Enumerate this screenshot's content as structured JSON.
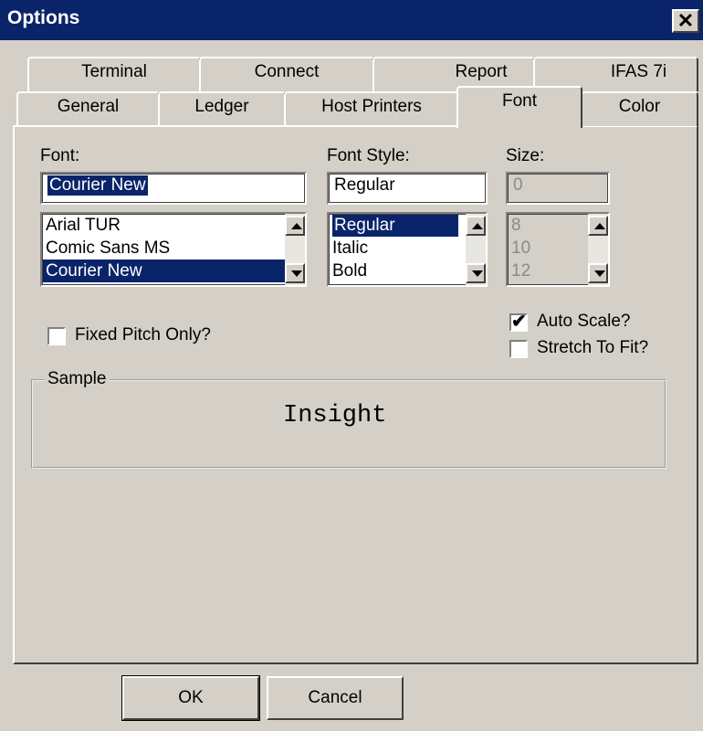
{
  "window": {
    "title": "Options",
    "close_label": "✕"
  },
  "tabs_back": [
    "Terminal",
    "Connect",
    "Report",
    "IFAS 7i"
  ],
  "tabs_front": [
    "General",
    "Ledger",
    "Host Printers",
    "Font",
    "Color"
  ],
  "font": {
    "label": "Font:",
    "value": "Courier New",
    "items": [
      "Arial TUR",
      "Comic Sans MS",
      "Courier New"
    ],
    "selected": "Courier New"
  },
  "font_style": {
    "label": "Font Style:",
    "value": "Regular",
    "items": [
      "Regular",
      "Italic",
      "Bold"
    ],
    "selected": "Regular"
  },
  "size": {
    "label": "Size:",
    "value": "0",
    "items": [
      "8",
      "10",
      "12"
    ]
  },
  "options": {
    "fixed_pitch": {
      "label": "Fixed Pitch Only?",
      "checked": false
    },
    "auto_scale": {
      "label": "Auto Scale?",
      "checked": true
    },
    "stretch": {
      "label": "Stretch To Fit?",
      "checked": false
    }
  },
  "sample": {
    "label": "Sample",
    "text": "Insight"
  },
  "buttons": {
    "ok": "OK",
    "cancel": "Cancel"
  },
  "colors": {
    "titlebar": "#0a246a",
    "face": "#d4d0c8",
    "selection": "#0a246a"
  },
  "icons": [
    "close-icon",
    "scroll-up-icon",
    "scroll-down-icon",
    "checkmark-icon"
  ]
}
